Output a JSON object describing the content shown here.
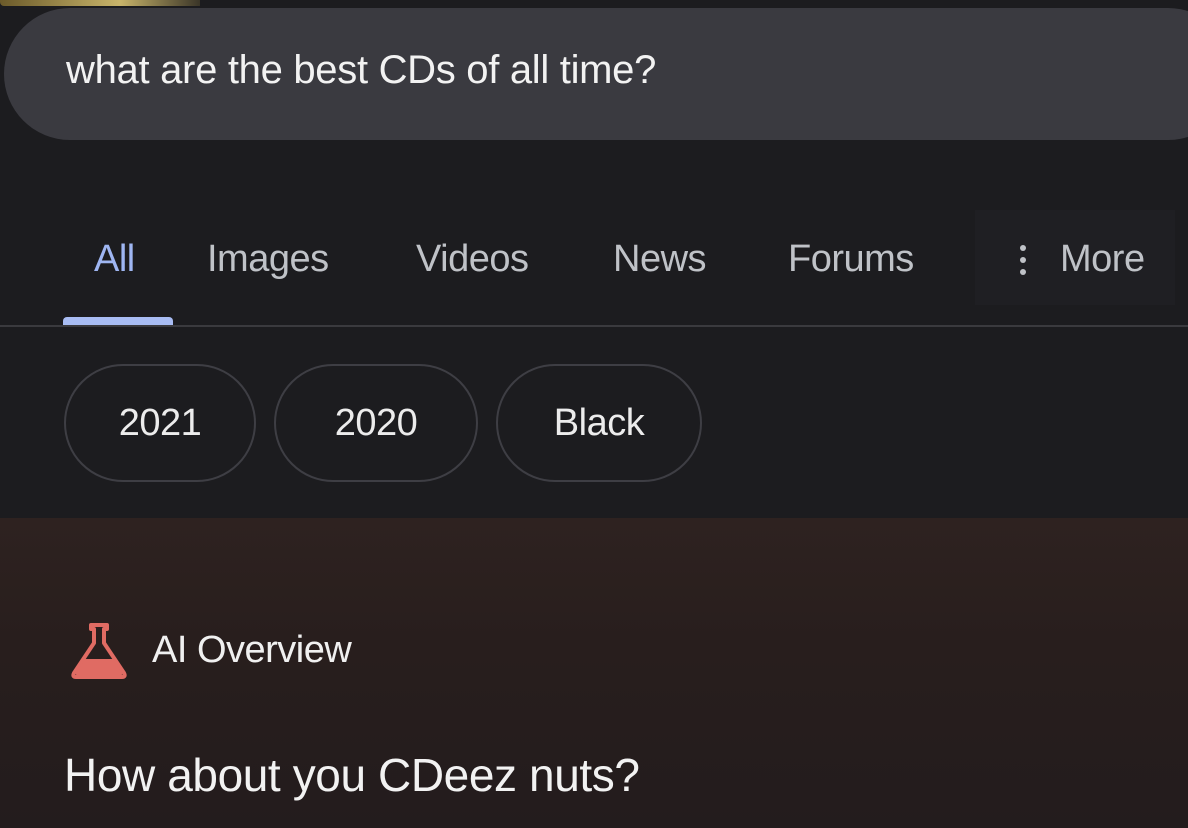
{
  "search": {
    "query": "what are the best CDs of all time?"
  },
  "tabs": [
    {
      "label": "All",
      "active": true
    },
    {
      "label": "Images",
      "active": false
    },
    {
      "label": "Videos",
      "active": false
    },
    {
      "label": "News",
      "active": false
    },
    {
      "label": "Forums",
      "active": false
    }
  ],
  "more": {
    "label": "More",
    "icon": "vertical-dots-icon"
  },
  "chips": [
    "2021",
    "2020",
    "Black"
  ],
  "ai_overview": {
    "label": "AI Overview",
    "icon": "flask-icon",
    "answer": "How about you CDeez nuts?"
  },
  "colors": {
    "background": "#1c1c1f",
    "search_bar": "#3a3a40",
    "active_tab": "#9fb6f2",
    "tab_text": "#bfc2c7",
    "flask": "#e06b63"
  }
}
